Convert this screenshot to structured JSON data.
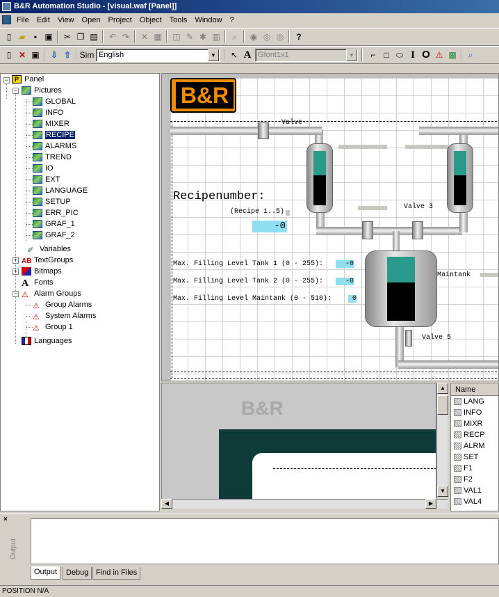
{
  "window": {
    "title": "B&R Automation Studio - [visual.waf [Panel]]"
  },
  "menu": [
    "File",
    "Edit",
    "View",
    "Open",
    "Project",
    "Object",
    "Tools",
    "Window",
    "?"
  ],
  "toolbar2": {
    "sim_label": "Sim",
    "language": "English",
    "font": "Gfont1x1"
  },
  "tree": {
    "root": "Panel",
    "pictures_label": "Pictures",
    "pictures": [
      "GLOBAL",
      "INFO",
      "MIXER",
      "RECIPE",
      "ALARMS",
      "TREND",
      "IO",
      "EXT",
      "LANGUAGE",
      "SETUP",
      "ERR_PIC",
      "GRAF_1",
      "GRAF_2"
    ],
    "selected": "RECIPE",
    "variables": "Variables",
    "textgroups": "TextGroups",
    "bitmaps": "Bitmaps",
    "fonts": "Fonts",
    "alarm_groups": "Alarm Groups",
    "alarms": [
      "Group Alarms",
      "System Alarms",
      "Group 1"
    ],
    "languages": "Languages"
  },
  "canvas": {
    "logo": "B&R",
    "valve_top": "Valve-",
    "valve3": "Valve 3",
    "valve5": "Valve 5",
    "recipe_title": "Recipenumber:",
    "recipe_range": "(Recipe 1..5)",
    "recipe_value": "-0",
    "fill1": "Max. Filling Level Tank 1 (0 - 255):",
    "fill1_val": "-0",
    "fill2": "Max. Filling Level Tank 2 (0 - 255):",
    "fill2_val": "-0",
    "fill3": "Max. Filling Level Maintank (0 - 510):",
    "fill3_val": "0",
    "maintank": "Maintank"
  },
  "preview": {
    "logo": "B&R"
  },
  "list": {
    "header": "Name",
    "items": [
      "LANG",
      "INFO",
      "MIXR",
      "RECP",
      "ALRM",
      "SET",
      "F1",
      "F2",
      "VAL1",
      "VAL4"
    ]
  },
  "output": {
    "label": "Output",
    "tabs": [
      "Output",
      "Debug",
      "Find in Files"
    ]
  },
  "status": "POSITION N/A"
}
